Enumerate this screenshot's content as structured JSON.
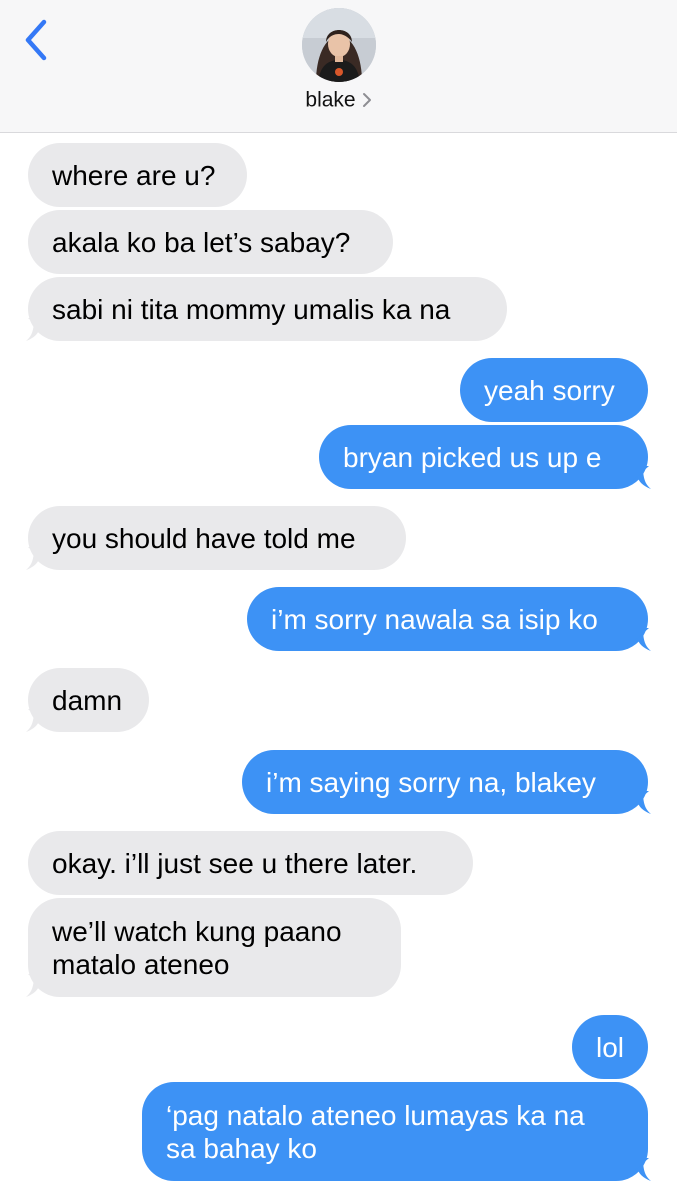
{
  "header": {
    "contact_name": "blake",
    "back_icon": "chevron-left-icon",
    "detail_icon": "chevron-right-icon"
  },
  "colors": {
    "sent_bubble": "#3d92f5",
    "received_bubble": "#e9e9eb",
    "accent": "#3478f6"
  },
  "messages": [
    {
      "from": "blake",
      "text": "where are u?"
    },
    {
      "from": "blake",
      "text": "akala ko ba let’s sabay?"
    },
    {
      "from": "blake",
      "text": "sabi ni tita mommy umalis ka na"
    },
    {
      "from": "me",
      "text": "yeah sorry"
    },
    {
      "from": "me",
      "text": "bryan picked us up e"
    },
    {
      "from": "blake",
      "text": "you should have told me"
    },
    {
      "from": "me",
      "text": "i’m sorry nawala sa isip ko"
    },
    {
      "from": "blake",
      "text": "damn"
    },
    {
      "from": "me",
      "text": "i’m saying sorry na, blakey"
    },
    {
      "from": "blake",
      "text": "okay. i’ll just see u there later."
    },
    {
      "from": "blake",
      "text": "we’ll watch kung paano\nmatalo ateneo"
    },
    {
      "from": "me",
      "text": "lol"
    },
    {
      "from": "me",
      "text": "‘pag natalo ateneo lumayas ka na\nsa bahay ko"
    }
  ]
}
